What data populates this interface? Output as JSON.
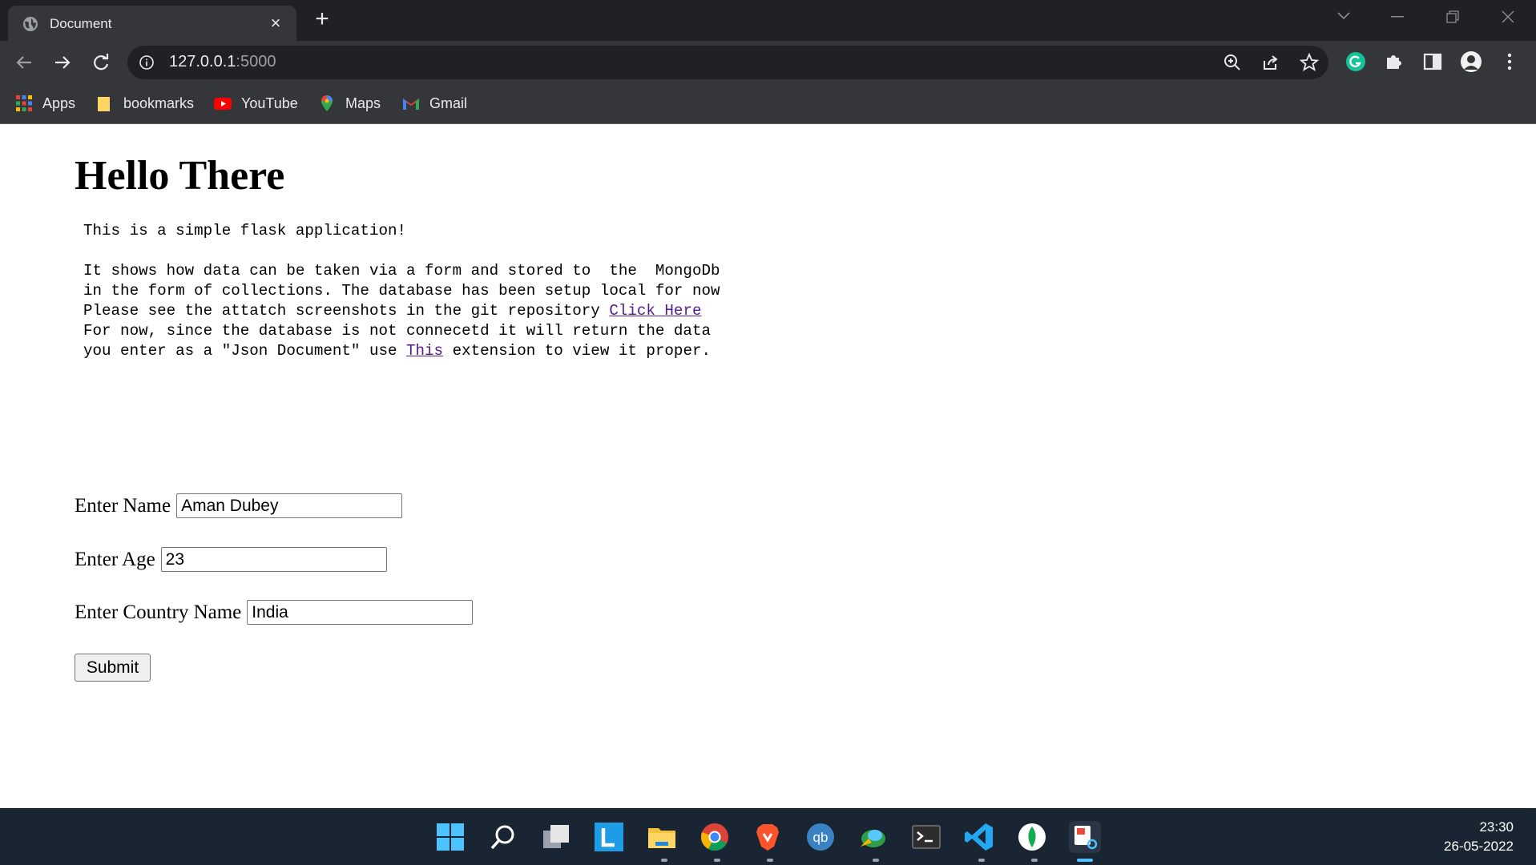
{
  "browser": {
    "tab": {
      "title": "Document",
      "icon": "globe-icon"
    },
    "address": {
      "host": "127.0.0.1",
      "port": ":5000"
    },
    "bookmarks": [
      {
        "label": "Apps",
        "icon": "apps-grid-icon"
      },
      {
        "label": "bookmarks",
        "icon": "folder-icon"
      },
      {
        "label": "YouTube",
        "icon": "youtube-icon"
      },
      {
        "label": "Maps",
        "icon": "maps-icon"
      },
      {
        "label": "Gmail",
        "icon": "gmail-icon"
      }
    ]
  },
  "page": {
    "heading": "Hello There",
    "intro": "This is a simple flask application!",
    "para2": {
      "line1": "It shows how data can be taken via a form and stored to  the  MongoDb",
      "line2": "in the form of collections. The database has been setup local for now",
      "line3": "Please see the attatch screenshots in the git repository ",
      "link": "Click Here"
    },
    "para3": {
      "line1": "For now, since the database is not connecetd it will return the data",
      "line2_before": "you enter as a \"Json Document\" use ",
      "link": "This",
      "line2_after": " extension to view it proper."
    },
    "form": {
      "name_label": "Enter Name",
      "name_value": "Aman Dubey",
      "age_label": "Enter Age",
      "age_value": "23",
      "country_label": "Enter Country Name",
      "country_value": "India",
      "submit_label": "Submit"
    }
  },
  "taskbar": {
    "time": "23:30",
    "date": "26-05-2022"
  },
  "colors": {
    "link": "#551a8b",
    "chrome_dark": "#202124",
    "chrome": "#35363a"
  }
}
